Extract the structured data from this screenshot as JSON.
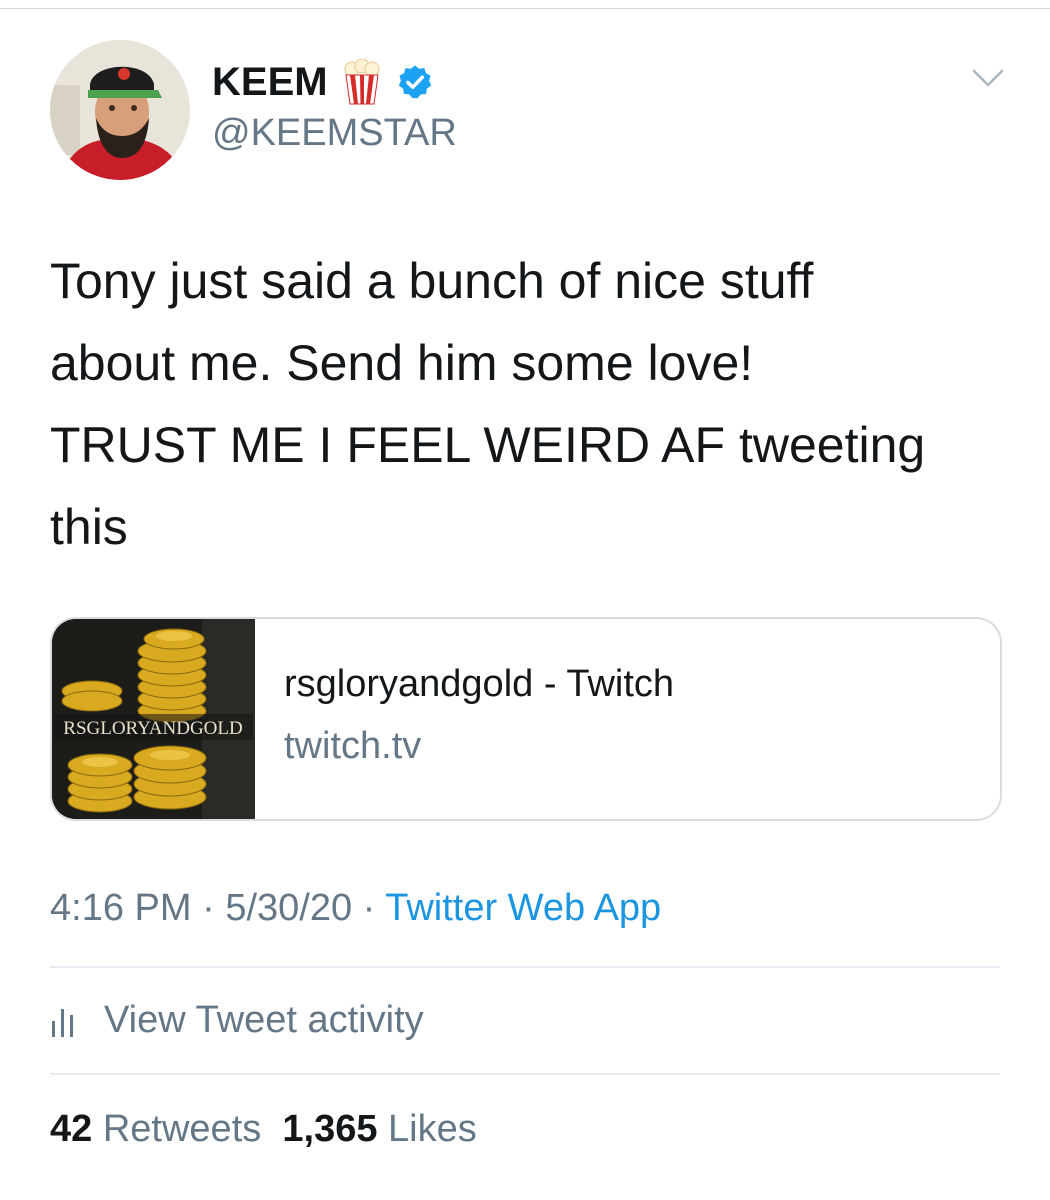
{
  "user": {
    "display_name": "KEEM",
    "handle": "@KEEMSTAR",
    "emoji_icon": "popcorn-icon",
    "verified_color": "#1da1f2"
  },
  "tweet": {
    "lines": [
      "Tony just said a bunch of nice stuff",
      "about me. Send him some love!",
      "TRUST ME I FEEL WEIRD AF tweeting",
      "this"
    ]
  },
  "card": {
    "thumb_text": "RSGLORYANDGOLD",
    "title": "rsgloryandgold - Twitch",
    "domain": "twitch.tv"
  },
  "meta": {
    "time": "4:16 PM",
    "sep1": " · ",
    "date": "5/30/20",
    "sep2": " · ",
    "source": "Twitter Web App"
  },
  "activity": {
    "label": "View Tweet activity"
  },
  "stats": {
    "retweets_count": "42",
    "retweets_label": "Retweets",
    "likes_count": "1,365",
    "likes_label": "Likes"
  },
  "colors": {
    "link": "#1b95e0",
    "muted": "#657786",
    "text": "#14171a"
  }
}
